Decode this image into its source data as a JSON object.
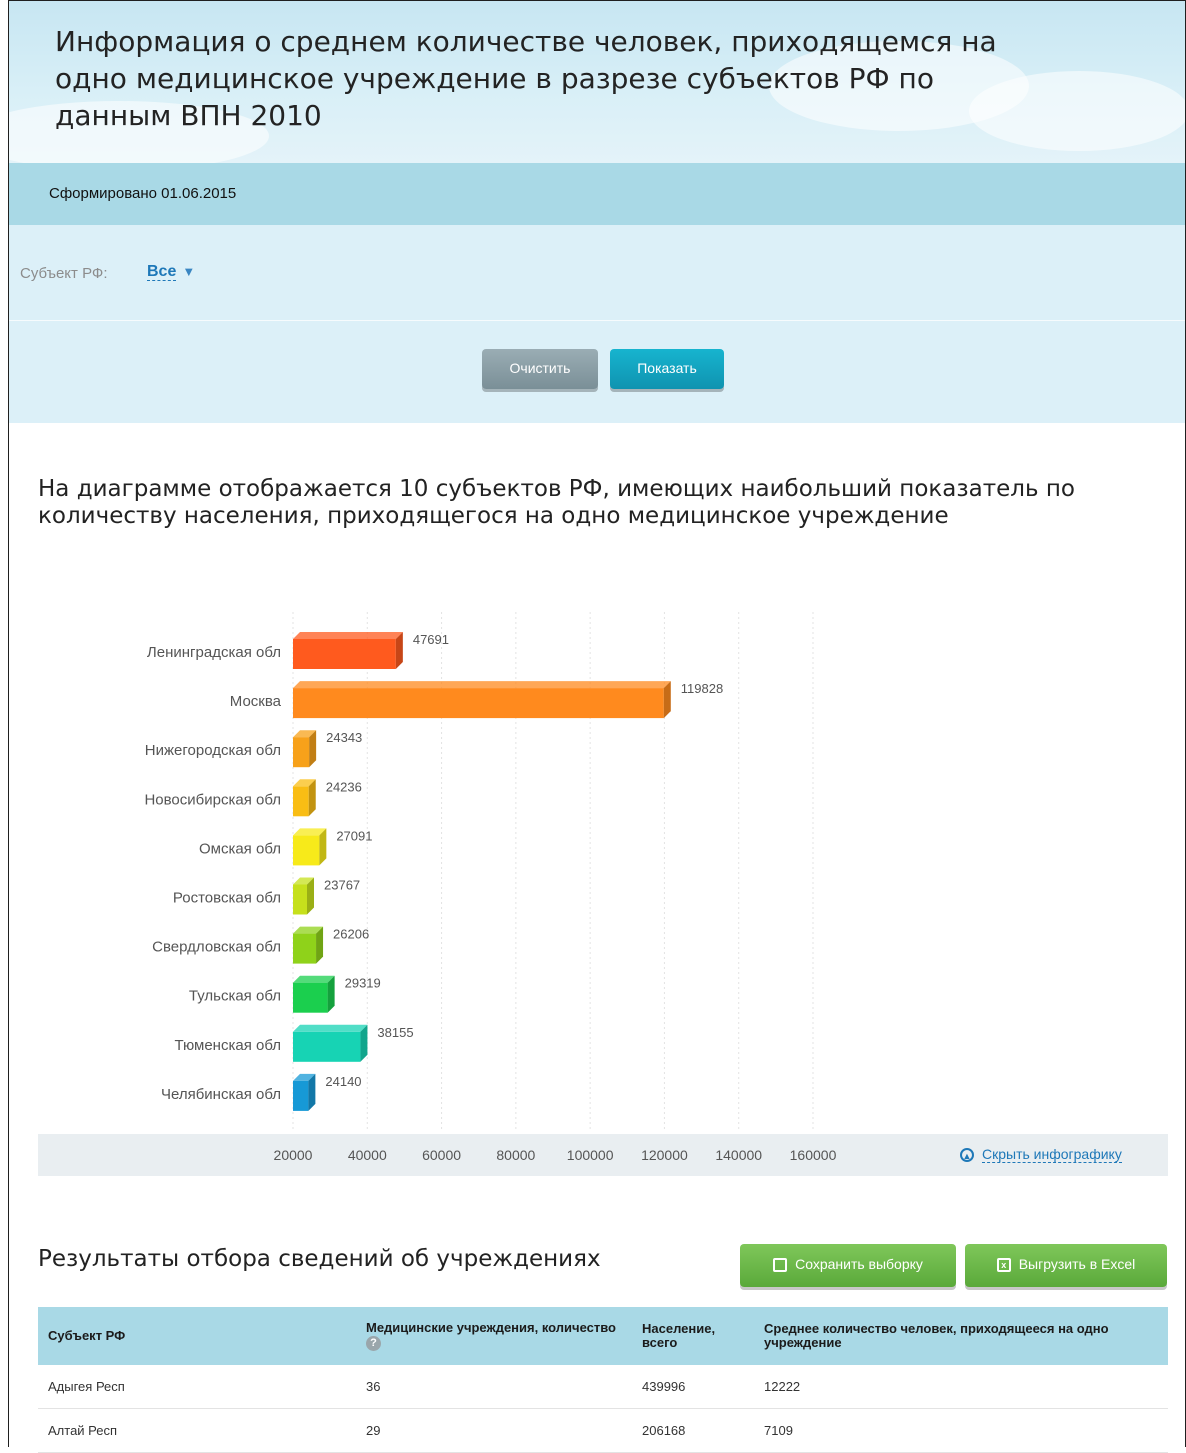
{
  "header": {
    "title": "Информация о среднем количестве человек, приходящемся на одно медицинское учреждение в разрезе субъектов РФ по данным ВПН 2010",
    "generated": "Сформировано 01.06.2015"
  },
  "filter": {
    "label": "Субъект РФ:",
    "value": "Все",
    "clear_label": "Очистить",
    "show_label": "Показать"
  },
  "chart_note": "На диаграмме отображается 10 субъектов РФ, имеющих наибольший показатель по количеству населения, приходящегося на одно медицинское учреждение",
  "chart_data": {
    "type": "bar",
    "orientation": "horizontal",
    "categories": [
      "Ленинградская обл",
      "Москва",
      "Нижегородская обл",
      "Новосибирская обл",
      "Омская обл",
      "Ростовская обл",
      "Свердловская обл",
      "Тульская обл",
      "Тюменская обл",
      "Челябинская обл"
    ],
    "values": [
      47691,
      119828,
      24343,
      24236,
      27091,
      23767,
      26206,
      29319,
      38155,
      24140
    ],
    "colors": [
      "#ff5a1e",
      "#ff8a1e",
      "#f7a11a",
      "#f9bd14",
      "#f7ea1a",
      "#c6e01c",
      "#8fd21a",
      "#1bcf4e",
      "#17d3b4",
      "#1799d6"
    ],
    "xticks": [
      "20000",
      "40000",
      "60000",
      "80000",
      "100000",
      "120000",
      "140000",
      "160000"
    ],
    "xlim": [
      20000,
      160000
    ],
    "grid": true
  },
  "hide_infographic": "Скрыть инфографику",
  "results": {
    "title": "Результаты отбора сведений об учреждениях",
    "save_label": "Сохранить выборку",
    "excel_label": "Выгрузить в Excel",
    "columns": [
      "Субъект РФ",
      "Медицинские учреждения, количество",
      "Население, всего",
      "Среднее количество человек, приходящееся на одно учреждение"
    ],
    "rows": [
      [
        "Адыгея Респ",
        "36",
        "439996",
        "12222"
      ],
      [
        "Алтай Респ",
        "29",
        "206168",
        "7109"
      ]
    ]
  }
}
